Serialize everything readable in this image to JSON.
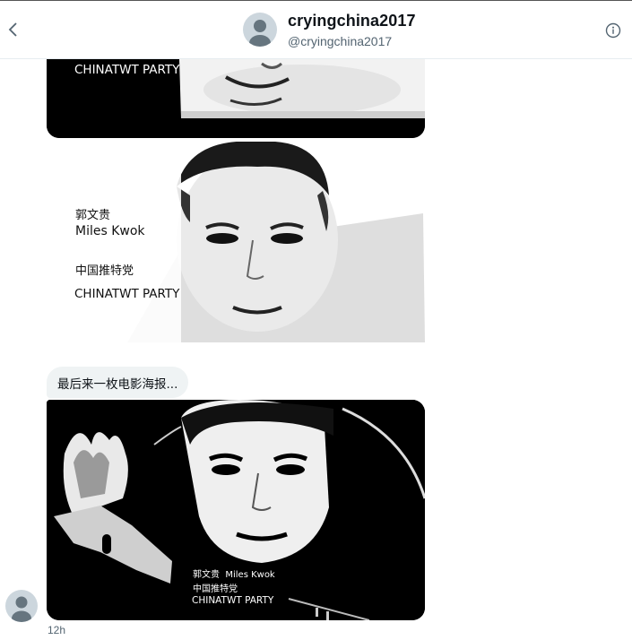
{
  "header": {
    "display_name": "cryingchina2017",
    "handle": "@cryingchina2017",
    "back_icon": "chevron-left-icon",
    "info_icon": "info-icon"
  },
  "image1": {
    "party_en": "CHINATWT PARTY"
  },
  "image2": {
    "name_cn": "郭文贵",
    "name_en": "Miles Kwok",
    "party_cn": "中国推特党",
    "party_en": "CHINATWT PARTY"
  },
  "message": {
    "text": "最后来一枚电影海报..."
  },
  "image3": {
    "name_line": "郭文贵  Miles Kwok",
    "party_cn": "中国推特党",
    "party_en": "CHINATWT PARTY"
  },
  "footer": {
    "timestamp": "12h"
  },
  "colors": {
    "accent_text": "#0f1419",
    "secondary_text": "#536471",
    "bubble_bg": "#eff3f4"
  }
}
